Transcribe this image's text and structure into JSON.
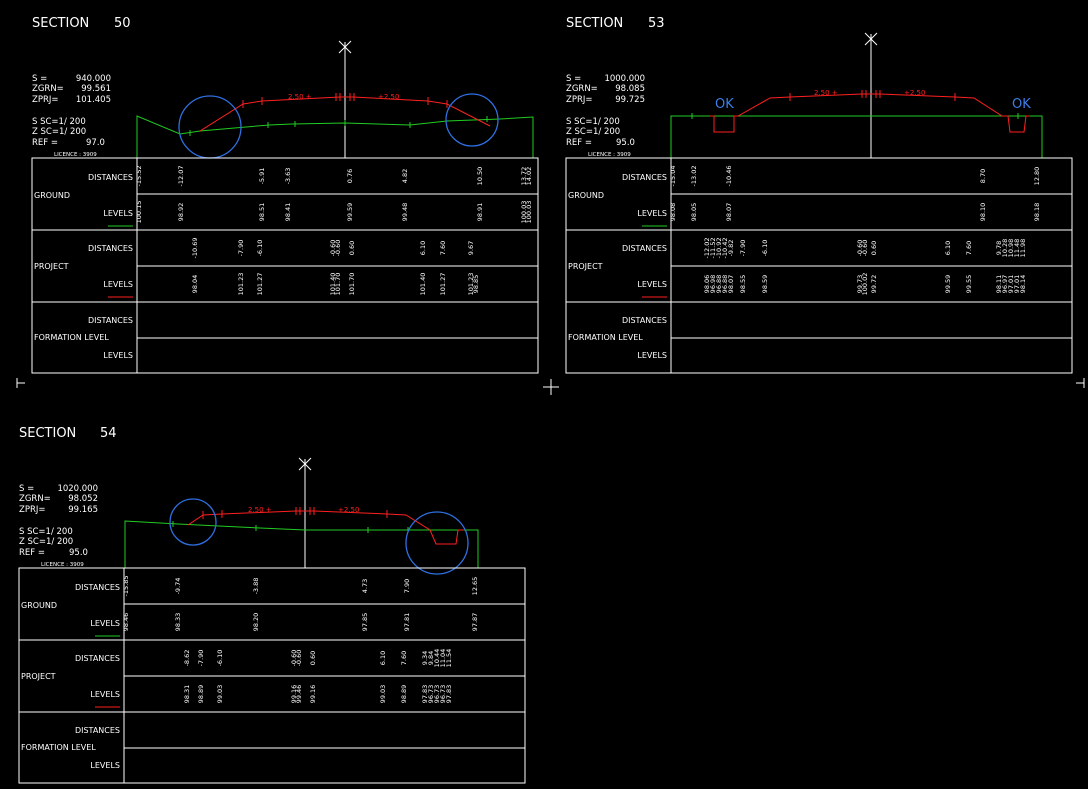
{
  "sections": [
    {
      "title_label": "SECTION",
      "number": "50",
      "info": {
        "s_label": "S   =",
        "s": "940.000",
        "zgrn_label": "ZGRN=",
        "zgrn": "99.561",
        "zprj_label": "ZPRJ=",
        "zprj": "101.405",
        "ssc": "S SC=1/  200",
        "zsc": "Z SC=1/  200",
        "ref_label": "REF =",
        "ref": "97.0",
        "licence": "LICENCE :  3909"
      },
      "ok_markers": [],
      "slope_labels": [
        "2.50 +",
        "+2.50"
      ],
      "ground_distances": [
        "-15.52",
        "-12.07",
        "-5.91",
        "-3.63",
        "0.76",
        "4.82",
        "10.50",
        "13.72",
        "14.02"
      ],
      "ground_levels": [
        "100.15",
        "98.92",
        "98.51",
        "98.41",
        "99.59",
        "99.48",
        "98.91",
        "100.03",
        "100.03"
      ],
      "project_distances": [
        "-10.69",
        "-7.90",
        "-6.10",
        "-0.60",
        "-0.60",
        "0.60",
        "6.10",
        "7.60",
        "9.67"
      ],
      "project_levels": [
        "98.04",
        "101.23",
        "101.27",
        "101.40",
        "101.70",
        "101.70",
        "101.40",
        "101.27",
        "101.23",
        "98.85"
      ]
    },
    {
      "title_label": "SECTION",
      "number": "53",
      "info": {
        "s_label": "S   =",
        "s": "1000.000",
        "zgrn_label": "ZGRN=",
        "zgrn": "98.085",
        "zprj_label": "ZPRJ=",
        "zprj": "99.725",
        "ssc": "S SC=1/  200",
        "zsc": "Z SC=1/  200",
        "ref_label": "REF =",
        "ref": "95.0",
        "licence": "LICENCE :  3909"
      },
      "ok_markers": [
        "OK",
        "OK"
      ],
      "slope_labels": [
        "2.50 +",
        "+2.50"
      ],
      "ground_distances": [
        "-15.04",
        "-13.02",
        "-10.46",
        "8.70",
        "12.80"
      ],
      "ground_levels": [
        "98.08",
        "98.05",
        "98.07",
        "98.10",
        "98.18"
      ],
      "project_distances": [
        "-12.02",
        "-11.52",
        "-10.92",
        "-10.42",
        "-9.82",
        "-7.90",
        "-6.10",
        "-0.60",
        "-0.60",
        "0.60",
        "6.10",
        "7.60",
        "9.78",
        "10.28",
        "10.98",
        "11.48",
        "11.98"
      ],
      "project_levels": [
        "98.06",
        "96.98",
        "96.88",
        "96.88",
        "98.07",
        "98.55",
        "98.59",
        "99.73",
        "100.02",
        "99.72",
        "99.59",
        "99.55",
        "98.11",
        "96.97",
        "97.01",
        "97.01",
        "98.14"
      ]
    },
    {
      "title_label": "SECTION",
      "number": "54",
      "info": {
        "s_label": "S   =",
        "s": "1020.000",
        "zgrn_label": "ZGRN=",
        "zgrn": "98.052",
        "zprj_label": "ZPRJ=",
        "zprj": "99.165",
        "ssc": "S SC=1/  200",
        "zsc": "Z SC=1/  200",
        "ref_label": "REF =",
        "ref": "95.0",
        "licence": "LICENCE :  3909"
      },
      "ok_markers": [],
      "slope_labels": [
        "2.50 +",
        "+2.50"
      ],
      "ground_distances": [
        "-15.85",
        "-9.74",
        "-3.88",
        "4.73",
        "7.90",
        "12.65"
      ],
      "ground_levels": [
        "98.46",
        "98.33",
        "98.20",
        "97.85",
        "97.81",
        "97.87"
      ],
      "project_distances": [
        "-8.62",
        "-7.90",
        "-6.10",
        "-0.60",
        "-0.60",
        "0.60",
        "6.10",
        "7.60",
        "9.34",
        "9.84",
        "10.44",
        "11.04",
        "11.54"
      ],
      "project_levels": [
        "98.31",
        "98.89",
        "99.03",
        "99.16",
        "99.46",
        "99.16",
        "99.03",
        "98.89",
        "97.83",
        "96.73",
        "96.73",
        "96.73",
        "97.83"
      ]
    }
  ],
  "table_rows": {
    "distances": "DISTANCES",
    "ground": "GROUND",
    "levels": "LEVELS",
    "project": "PROJECT",
    "formation": "FORMATION LEVEL"
  },
  "colors": {
    "ground": "#22cc22",
    "project": "#ff2020",
    "circle": "#2f6fe0",
    "ok": "#3d7ee8",
    "grid": "#ffffff"
  }
}
